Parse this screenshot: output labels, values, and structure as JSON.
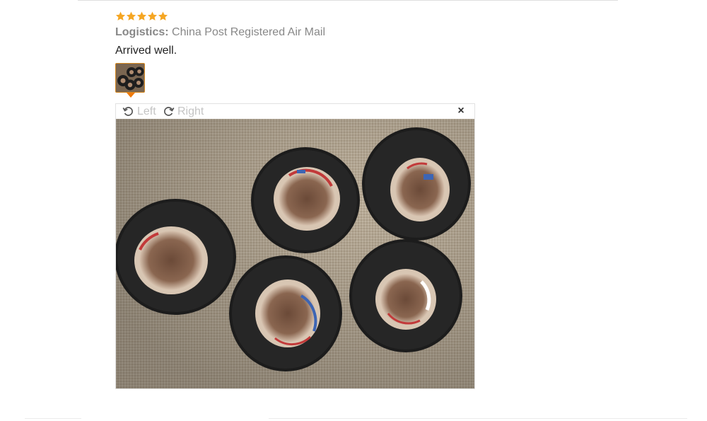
{
  "review": {
    "rating": 5,
    "rating_max": 5,
    "logistics_label": "Logistics:",
    "logistics_value": "China Post Registered Air Mail",
    "text": "Arrived well."
  },
  "viewer": {
    "rotate_left_label": "Left",
    "rotate_right_label": "Right",
    "close_label": "×"
  },
  "colors": {
    "star": "#f5a623",
    "thumb_border": "#d8891f",
    "pointer": "#f07a0b"
  },
  "icons": {
    "rotate_left": "rotate-left-icon",
    "rotate_right": "rotate-right-icon",
    "close": "close-icon",
    "star": "star-icon"
  }
}
